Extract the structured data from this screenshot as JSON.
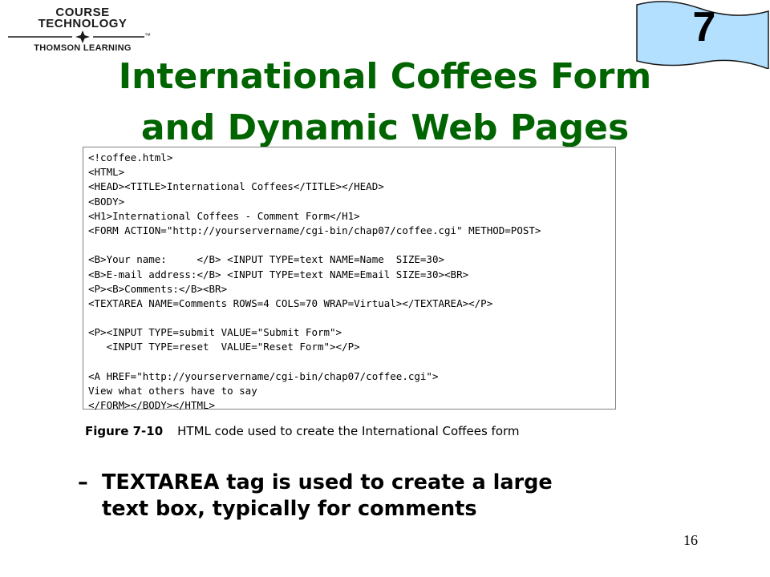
{
  "logo": {
    "line1": "COURSE",
    "line2": "TECHNOLOGY",
    "line3": "THOMSON LEARNING",
    "tm": "™"
  },
  "badge": {
    "chapter": "7",
    "fill": "#b3e0ff",
    "border": "#1a1a1a"
  },
  "title": {
    "line1": "International Coffees Form",
    "line2": "and Dynamic Web Pages",
    "color": "#006400"
  },
  "code": [
    "<!coffee.html>",
    "<HTML>",
    "<HEAD><TITLE>International Coffees</TITLE></HEAD>",
    "<BODY>",
    "<H1>International Coffees - Comment Form</H1>",
    "<FORM ACTION=\"http://yourservername/cgi-bin/chap07/coffee.cgi\" METHOD=POST>",
    "",
    "<B>Your name:     </B> <INPUT TYPE=text NAME=Name  SIZE=30>",
    "<B>E-mail address:</B> <INPUT TYPE=text NAME=Email SIZE=30><BR>",
    "<P><B>Comments:</B><BR>",
    "<TEXTAREA NAME=Comments ROWS=4 COLS=70 WRAP=Virtual></TEXTAREA></P>",
    "",
    "<P><INPUT TYPE=submit VALUE=\"Submit Form\">",
    "   <INPUT TYPE=reset  VALUE=\"Reset Form\"></P>",
    "",
    "<A HREF=\"http://yourservername/cgi-bin/chap07/coffee.cgi\">",
    "View what others have to say",
    "</FORM></BODY></HTML>"
  ],
  "caption": {
    "figure": "Figure 7-10",
    "text": "HTML code used to create the International Coffees form"
  },
  "bullet": {
    "dash": "–",
    "line1": "TEXTAREA tag is used to create a large",
    "line2": "text box, typically for comments"
  },
  "page_number": "16"
}
